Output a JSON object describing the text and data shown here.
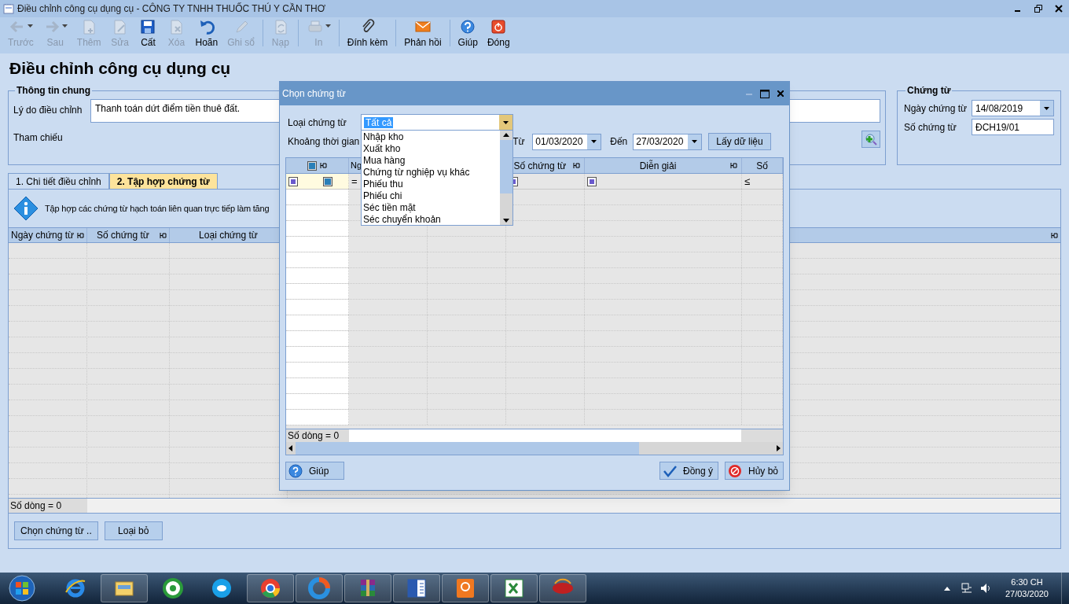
{
  "window": {
    "title": "Điều chỉnh công cụ dụng cụ - CÔNG TY TNHH THUỐC THÚ Y CẦN THƠ"
  },
  "toolbar": [
    {
      "kind": "back",
      "label": "Trước",
      "disabled": true,
      "dropdown": true
    },
    {
      "kind": "forward",
      "label": "Sau",
      "disabled": true,
      "dropdown": true
    },
    {
      "kind": "add",
      "label": "Thêm",
      "disabled": true,
      "dropdown": false
    },
    {
      "kind": "edit",
      "label": "Sửa",
      "disabled": true,
      "dropdown": false
    },
    {
      "kind": "save",
      "label": "Cất",
      "disabled": false,
      "dropdown": false
    },
    {
      "kind": "delete",
      "label": "Xóa",
      "disabled": true,
      "dropdown": false
    },
    {
      "kind": "undo",
      "label": "Hoãn",
      "disabled": false,
      "dropdown": false
    },
    {
      "kind": "pencil",
      "label": "Ghi sổ",
      "disabled": true,
      "dropdown": false
    },
    {
      "kind": "separator"
    },
    {
      "kind": "reload",
      "label": "Nạp",
      "disabled": true,
      "dropdown": false
    },
    {
      "kind": "separator"
    },
    {
      "kind": "print",
      "label": "In",
      "disabled": true,
      "dropdown": true
    },
    {
      "kind": "separator"
    },
    {
      "kind": "attach",
      "label": "Đính kèm",
      "disabled": false,
      "dropdown": false
    },
    {
      "kind": "separator"
    },
    {
      "kind": "mail",
      "label": "Phản hồi",
      "disabled": false,
      "dropdown": false
    },
    {
      "kind": "separator"
    },
    {
      "kind": "help",
      "label": "Giúp",
      "disabled": false,
      "dropdown": false
    },
    {
      "kind": "close",
      "label": "Đóng",
      "disabled": false,
      "dropdown": false
    }
  ],
  "page_title": "Điều chỉnh công cụ dụng cụ",
  "general_info": {
    "title": "Thông tin chung",
    "reason_label": "Lý do điều chỉnh",
    "reason_value": "Thanh toán dứt điểm tiền thuê đất.",
    "reference_label": "Tham chiếu"
  },
  "voucher": {
    "title": "Chứng từ",
    "date_label": "Ngày chứng từ",
    "date_value": "14/08/2019",
    "number_label": "Số chứng từ",
    "number_value": "ĐCH19/01"
  },
  "tabs": [
    {
      "label": "1. Chi tiết điều chỉnh",
      "selected": false
    },
    {
      "label": "2. Tập hợp chứng từ",
      "selected": true
    }
  ],
  "info_text": "Tập hợp các chứng từ hạch toán liên quan trực tiếp làm tăng",
  "grid": {
    "columns": [
      {
        "label": "Ngày chứng từ",
        "pinned": true
      },
      {
        "label": "Số chứng từ",
        "pinned": true
      },
      {
        "label": "Loại chứng từ",
        "pinned": false
      }
    ],
    "footer": "Số dòng = 0"
  },
  "actions": [
    "Chọn chứng từ ..",
    "Loại bỏ"
  ],
  "dialog": {
    "title": "Chọn chứng từ",
    "type_label": "Loại chứng từ",
    "type_value": "Tất cả",
    "period_label": "Khoảng thời gian",
    "from_label": "Từ",
    "from_value": "01/03/2020",
    "to_label": "Đến",
    "to_value": "27/03/2020",
    "fetch_button": "Lấy dữ liệu",
    "dropdown": [
      {
        "label": "Nhập kho",
        "selected": false
      },
      {
        "label": "Xuất kho",
        "selected": false
      },
      {
        "label": "Mua hàng",
        "selected": false
      },
      {
        "label": "Chứng từ nghiệp vụ khác",
        "selected": false
      },
      {
        "label": "Phiếu thu",
        "selected": false
      },
      {
        "label": "Phiếu chi",
        "selected": false
      },
      {
        "label": "Séc tiền mặt",
        "selected": false
      },
      {
        "label": "Séc chuyển khoản",
        "selected": false
      }
    ],
    "columns": [
      {
        "kind": "check",
        "pinned": true
      },
      {
        "kind": "text",
        "label": "Ng",
        "filter_op": "="
      },
      {
        "kind": "blank"
      },
      {
        "kind": "text",
        "label": "Số chứng từ",
        "pinned": true
      },
      {
        "kind": "text",
        "label": "Diễn giải",
        "pinned": true
      },
      {
        "kind": "text",
        "label": "Số",
        "pinned": false,
        "filter_op": "≤"
      }
    ],
    "footer": "Số dòng = 0",
    "buttons": [
      {
        "kind": "help",
        "label": "Giúp"
      },
      {
        "kind": "ok",
        "label": "Đồng ý"
      },
      {
        "kind": "cancel",
        "label": "Hủy bỏ"
      }
    ]
  },
  "taskbar": {
    "apps": [
      {
        "kind": "ie",
        "running": false
      },
      {
        "kind": "folder",
        "running": true
      },
      {
        "kind": "coccoc",
        "running": false
      },
      {
        "kind": "skype",
        "running": false
      },
      {
        "kind": "chrome",
        "running": true
      },
      {
        "kind": "ring",
        "running": true
      },
      {
        "kind": "winrar",
        "running": true
      },
      {
        "kind": "word",
        "running": true
      },
      {
        "kind": "pdf",
        "running": true
      },
      {
        "kind": "excel",
        "running": true
      },
      {
        "kind": "htkk",
        "running": true
      }
    ],
    "time": "6:30 CH",
    "date": "27/03/2020"
  }
}
